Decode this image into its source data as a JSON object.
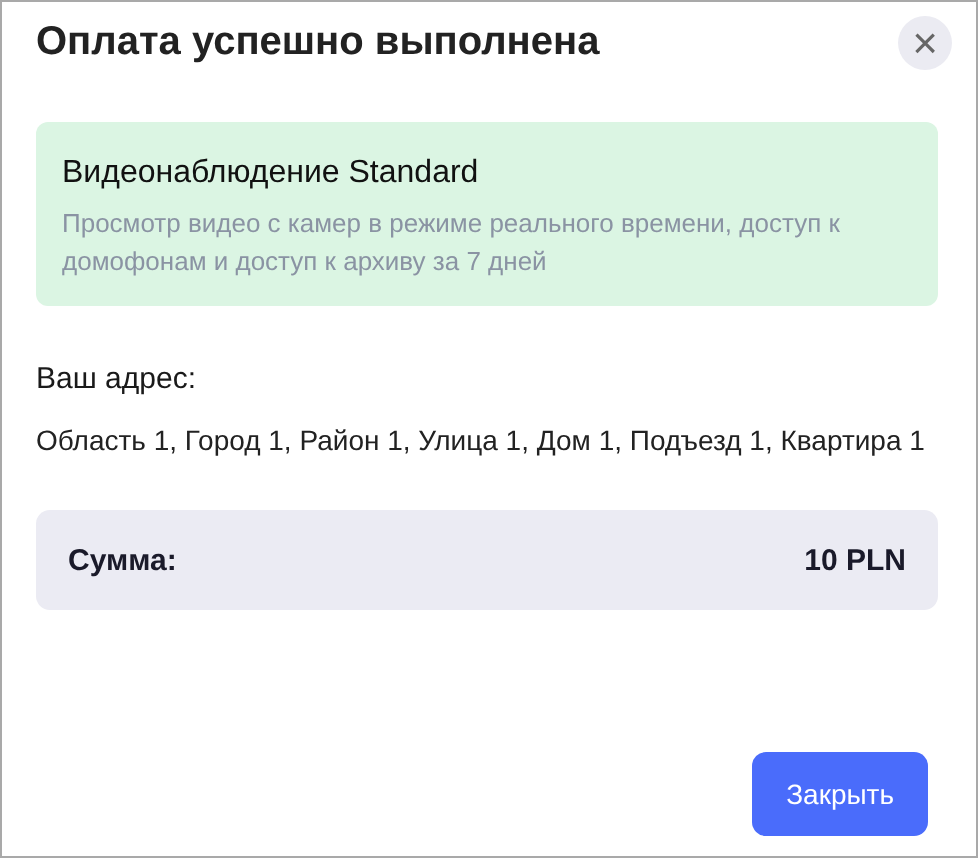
{
  "dialog": {
    "title": "Оплата успешно выполнена",
    "close_icon": "×"
  },
  "plan": {
    "name": "Видеонаблюдение Standard",
    "description": "Просмотр видео с камер в режиме реального времени, доступ к домофонам и доступ к архиву за 7 дней"
  },
  "address": {
    "label": "Ваш адрес:",
    "value": "Область 1, Город 1, Район 1, Улица 1, Дом 1, Подъезд 1, Квартира 1"
  },
  "total": {
    "label": "Сумма:",
    "value": "10 PLN"
  },
  "buttons": [
    "Закрыть"
  ]
}
